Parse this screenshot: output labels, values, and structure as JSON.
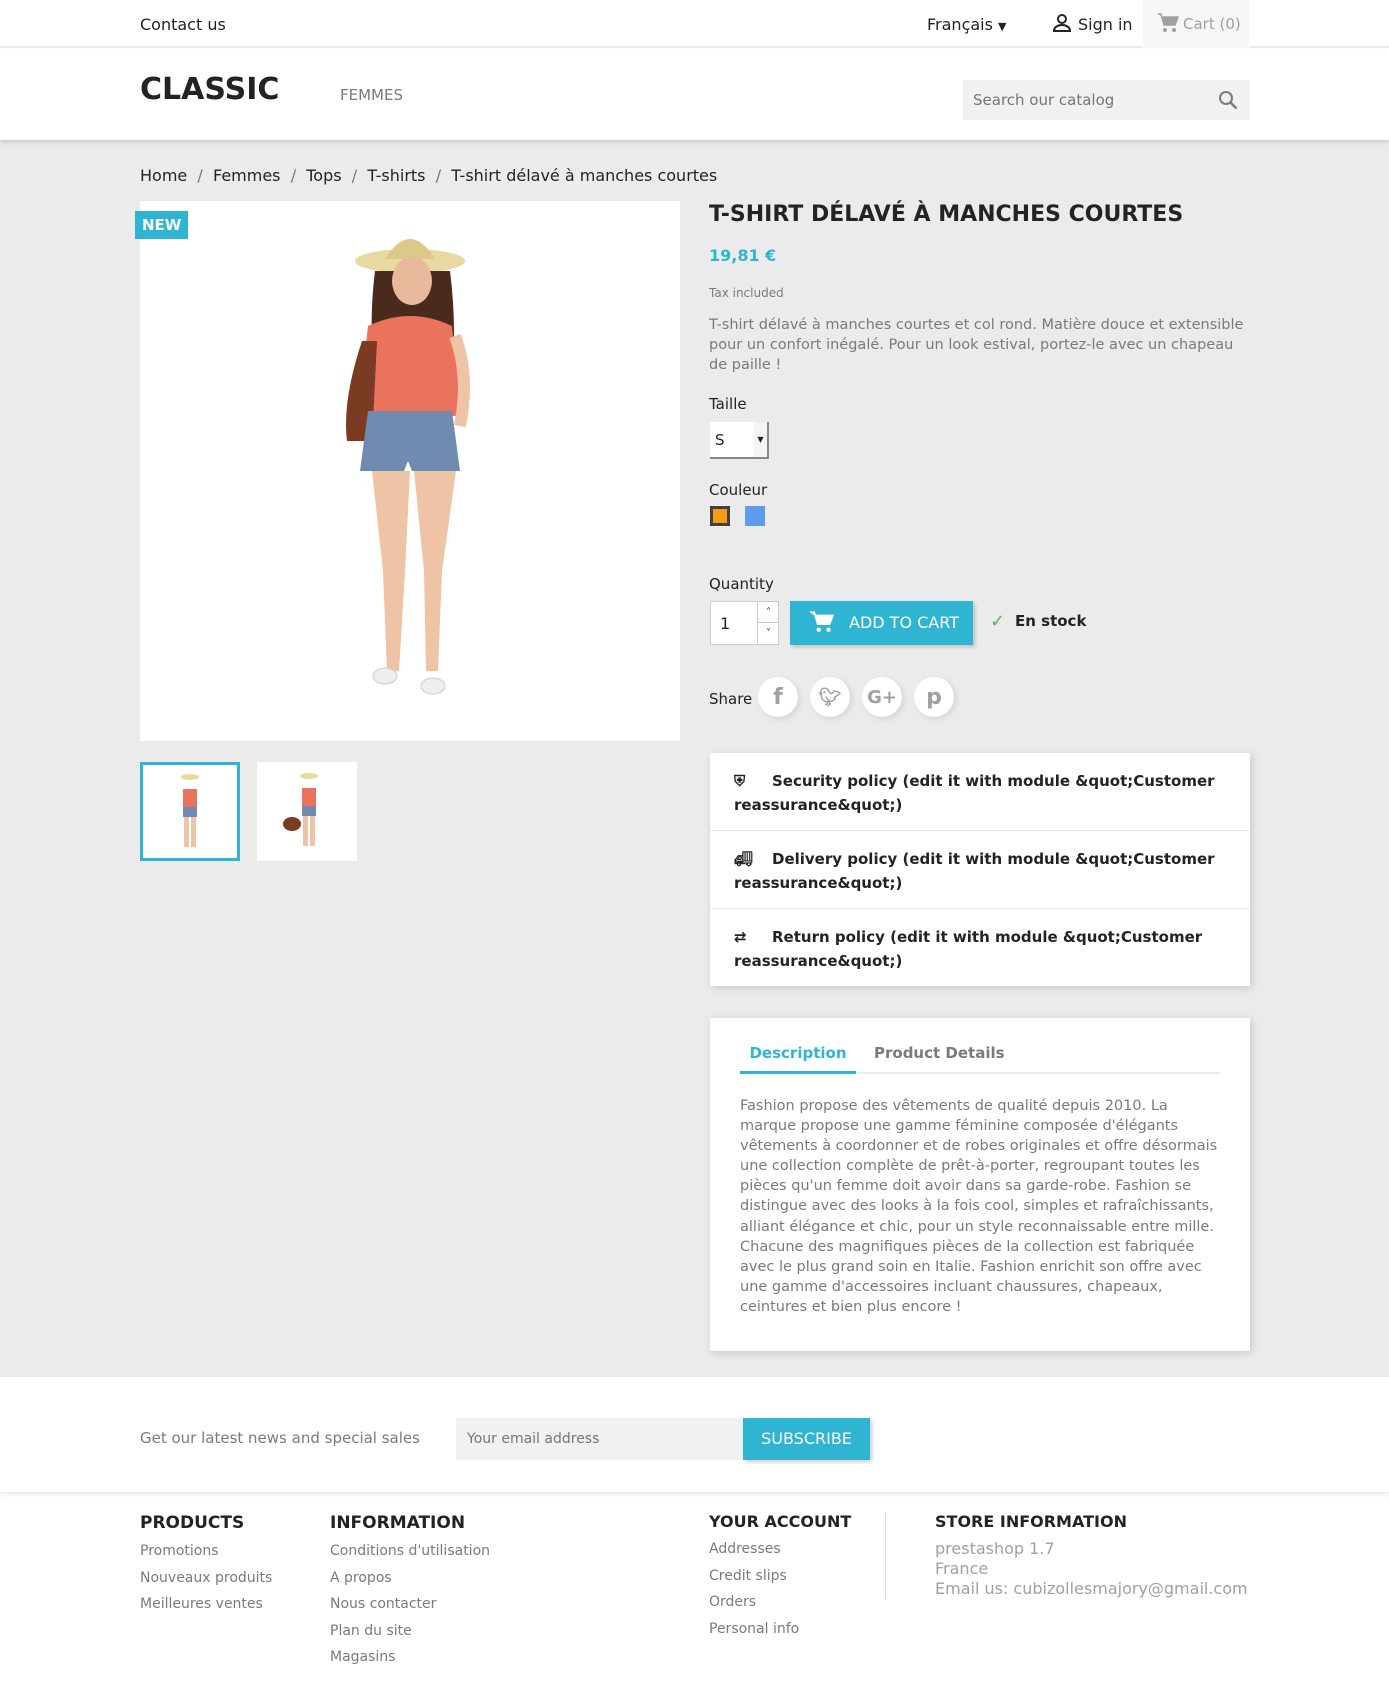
{
  "topbar": {
    "contact": "Contact us",
    "language": "Français",
    "signin": "Sign in",
    "cart": "Cart (0)"
  },
  "header": {
    "logo": "CLASSIC",
    "menu": [
      "FEMMES"
    ],
    "search_placeholder": "Search our catalog"
  },
  "breadcrumb": [
    "Home",
    "Femmes",
    "Tops",
    "T-shirts",
    "T-shirt délavé à manches courtes"
  ],
  "product": {
    "badge": "NEW",
    "title": "T-SHIRT DÉLAVÉ À MANCHES COURTES",
    "price": "19,81 €",
    "tax": "Tax included",
    "short_desc": "T-shirt délavé à manches courtes et col rond. Matière douce et extensible pour un confort inégalé. Pour un look estival, portez-le avec un chapeau de paille !",
    "size_label": "Taille",
    "size_value": "S",
    "color_label": "Couleur",
    "colors": [
      "#f39d12",
      "#5d9cec"
    ],
    "qty_label": "Quantity",
    "qty": "1",
    "add_to_cart": "ADD TO CART",
    "stock": "En stock",
    "share_label": "Share",
    "share": [
      "facebook",
      "twitter",
      "google-plus",
      "pinterest"
    ],
    "accent": "#2fb5d2"
  },
  "reassurance": [
    "Security policy (edit it with module &quot;Customer reassurance&quot;)",
    "Delivery policy (edit it with module &quot;Customer reassurance&quot;)",
    "Return policy (edit it with module &quot;Customer reassurance&quot;)"
  ],
  "tabs": {
    "items": [
      "Description",
      "Product Details"
    ],
    "active": 0,
    "description": "Fashion propose des vêtements de qualité depuis 2010. La marque propose une gamme féminine composée d'élégants vêtements à coordonner et de robes originales et offre désormais une collection complète de prêt-à-porter, regroupant toutes les pièces qu'un femme doit avoir dans sa garde-robe. Fashion se distingue avec des looks à la fois cool, simples et rafraîchissants, alliant élégance et chic, pour un style reconnaissable entre mille. Chacune des magnifiques pièces de la collection est fabriquée avec le plus grand soin en Italie. Fashion enrichit son offre avec une gamme d'accessoires incluant chaussures, chapeaux, ceintures et bien plus encore !"
  },
  "newsletter": {
    "text": "Get our latest news and special sales",
    "placeholder": "Your email address",
    "button": "SUBSCRIBE"
  },
  "footer": {
    "products": {
      "title": "PRODUCTS",
      "items": [
        "Promotions",
        "Nouveaux produits",
        "Meilleures ventes"
      ]
    },
    "information": {
      "title": "INFORMATION",
      "items": [
        "Conditions d'utilisation",
        "A propos",
        "Nous contacter",
        "Plan du site",
        "Magasins"
      ]
    },
    "account": {
      "title": "YOUR ACCOUNT",
      "items": [
        "Addresses",
        "Credit slips",
        "Orders",
        "Personal info"
      ]
    },
    "store": {
      "title": "STORE INFORMATION",
      "lines": [
        "prestashop 1.7",
        "France",
        "Email us: cubizollesmajory@gmail.com"
      ]
    }
  }
}
